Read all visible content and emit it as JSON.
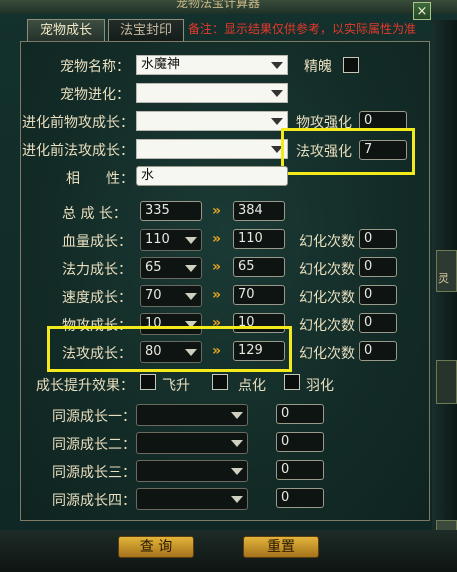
{
  "window": {
    "title": "宠物法宝计算器",
    "close_icon": "×"
  },
  "tabs": [
    {
      "label": "宠物成长"
    },
    {
      "label": "法宝封印"
    }
  ],
  "note": "备注：显示结果仅供参考，以实际属性为准",
  "form": {
    "pet_name": {
      "label": "宠物名称：",
      "value": "水魔神"
    },
    "jingpo": {
      "label": "精魄"
    },
    "pet_evolve": {
      "label": "宠物进化：",
      "value": ""
    },
    "phys_pre": {
      "label": "进化前物攻成长：",
      "value": ""
    },
    "magic_pre": {
      "label": "进化前法攻成长：",
      "value": ""
    },
    "phys_enhance": {
      "label": "物攻强化",
      "value": "0"
    },
    "magic_enhance": {
      "label": "法攻强化",
      "value": "7"
    },
    "attribute": {
      "label_a": "相",
      "label_b": "性：",
      "value": "水"
    }
  },
  "growth": {
    "total": {
      "label": "总 成 长：",
      "base": "335",
      "result": "384"
    },
    "rows": [
      {
        "label": "血量成长：",
        "base": "110",
        "result": "110",
        "huan_label": "幻化次数",
        "huan": "0"
      },
      {
        "label": "法力成长：",
        "base": "65",
        "result": "65",
        "huan_label": "幻化次数",
        "huan": "0"
      },
      {
        "label": "速度成长：",
        "base": "70",
        "result": "70",
        "huan_label": "幻化次数",
        "huan": "0"
      },
      {
        "label": "物攻成长：",
        "base": "10",
        "result": "10",
        "huan_label": "幻化次数",
        "huan": "0"
      },
      {
        "label": "法攻成长：",
        "base": "80",
        "result": "129",
        "huan_label": "幻化次数",
        "huan": "0"
      }
    ],
    "arrow": "»"
  },
  "effects": {
    "label": "成长提升效果：",
    "options": [
      {
        "label": "飞升"
      },
      {
        "label": "点化"
      },
      {
        "label": "羽化"
      }
    ]
  },
  "tongyuan": [
    {
      "label": "同源成长一：",
      "value": "0"
    },
    {
      "label": "同源成长二：",
      "value": "0"
    },
    {
      "label": "同源成长三：",
      "value": "0"
    },
    {
      "label": "同源成长四：",
      "value": "0"
    }
  ],
  "buttons": {
    "query": "查 询",
    "reset": "重置"
  },
  "side": {
    "deco_text": "灵"
  },
  "colors": {
    "highlight": "#f3ea1c",
    "note": "#e6392b",
    "button": "#e3b43a"
  }
}
